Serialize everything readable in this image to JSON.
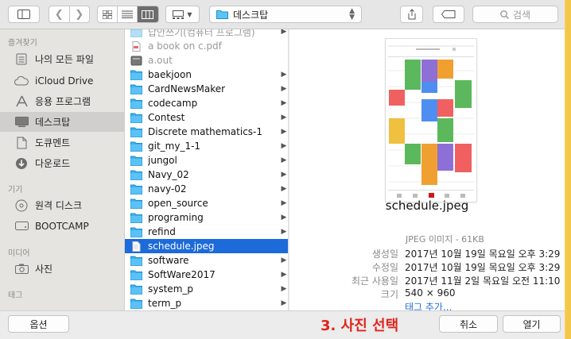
{
  "toolbar": {
    "location": "데스크탑",
    "search_placeholder": "검색"
  },
  "sidebar": {
    "favorites_header": "즐겨찾기",
    "favorites": [
      {
        "label": "나의 모든 파일",
        "icon": "all-files-icon"
      },
      {
        "label": "iCloud Drive",
        "icon": "cloud-icon"
      },
      {
        "label": "응용 프로그램",
        "icon": "applications-icon"
      },
      {
        "label": "데스크탑",
        "icon": "desktop-icon",
        "selected": true
      },
      {
        "label": "도큐멘트",
        "icon": "document-icon"
      },
      {
        "label": "다운로드",
        "icon": "download-icon"
      }
    ],
    "devices_header": "기기",
    "devices": [
      {
        "label": "원격 디스크",
        "icon": "disc-icon"
      },
      {
        "label": "BOOTCAMP",
        "icon": "drive-icon"
      }
    ],
    "media_header": "미디어",
    "media": [
      {
        "label": "사진",
        "icon": "camera-icon"
      }
    ],
    "tags_header": "태그"
  },
  "files": [
    {
      "name": "답안쓰기(컴퓨터 프로그램)",
      "type": "folder",
      "dim": true
    },
    {
      "name": "a book on c.pdf",
      "type": "pdf",
      "dim": true
    },
    {
      "name": "a.out",
      "type": "binary",
      "dim": true
    },
    {
      "name": "baekjoon",
      "type": "folder"
    },
    {
      "name": "CardNewsMaker",
      "type": "folder"
    },
    {
      "name": "codecamp",
      "type": "folder"
    },
    {
      "name": "Contest",
      "type": "folder"
    },
    {
      "name": "Discrete mathematics-1",
      "type": "folder"
    },
    {
      "name": "git_my_1-1",
      "type": "folder"
    },
    {
      "name": "jungol",
      "type": "folder"
    },
    {
      "name": "Navy_02",
      "type": "folder"
    },
    {
      "name": "navy-02",
      "type": "folder"
    },
    {
      "name": "open_source",
      "type": "folder"
    },
    {
      "name": "programing",
      "type": "folder"
    },
    {
      "name": "refind",
      "type": "folder"
    },
    {
      "name": "schedule.jpeg",
      "type": "image",
      "selected": true
    },
    {
      "name": "software",
      "type": "folder"
    },
    {
      "name": "SoftWare2017",
      "type": "folder"
    },
    {
      "name": "system_p",
      "type": "folder"
    },
    {
      "name": "term_p",
      "type": "folder"
    }
  ],
  "preview": {
    "filename": "schedule.jpeg",
    "kind": "JPEG 이미지 - 61KB",
    "created_label": "생성일",
    "created": "2017년 10월 19일 목요일 오후 3:29",
    "modified_label": "수정일",
    "modified": "2017년 10월 19일 목요일 오후 3:29",
    "opened_label": "최근 사용일",
    "opened": "2017년 11월 2일 목요일 오전 11:10",
    "size_label": "크기",
    "size": "540 × 960",
    "tags_link": "태그 추가..."
  },
  "buttons": {
    "options": "옵션",
    "cancel": "취소",
    "open": "열기"
  },
  "annotation": "3. 사진 선택",
  "colors": {
    "selection": "#1d6ada",
    "folder": "#1aa0e8",
    "annotation": "#e0241c"
  }
}
